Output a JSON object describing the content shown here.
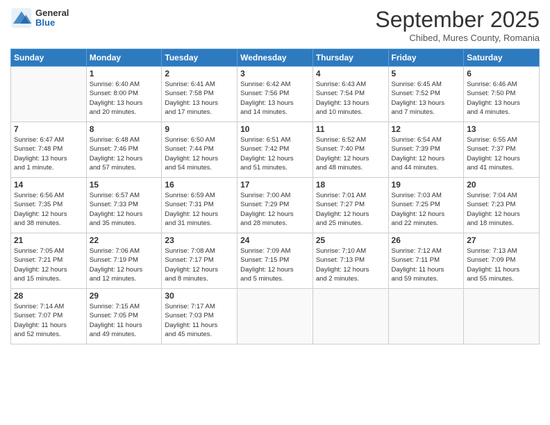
{
  "logo": {
    "general": "General",
    "blue": "Blue"
  },
  "title": "September 2025",
  "location": "Chibed, Mures County, Romania",
  "days_of_week": [
    "Sunday",
    "Monday",
    "Tuesday",
    "Wednesday",
    "Thursday",
    "Friday",
    "Saturday"
  ],
  "weeks": [
    [
      {
        "day": "",
        "info": ""
      },
      {
        "day": "1",
        "info": "Sunrise: 6:40 AM\nSunset: 8:00 PM\nDaylight: 13 hours\nand 20 minutes."
      },
      {
        "day": "2",
        "info": "Sunrise: 6:41 AM\nSunset: 7:58 PM\nDaylight: 13 hours\nand 17 minutes."
      },
      {
        "day": "3",
        "info": "Sunrise: 6:42 AM\nSunset: 7:56 PM\nDaylight: 13 hours\nand 14 minutes."
      },
      {
        "day": "4",
        "info": "Sunrise: 6:43 AM\nSunset: 7:54 PM\nDaylight: 13 hours\nand 10 minutes."
      },
      {
        "day": "5",
        "info": "Sunrise: 6:45 AM\nSunset: 7:52 PM\nDaylight: 13 hours\nand 7 minutes."
      },
      {
        "day": "6",
        "info": "Sunrise: 6:46 AM\nSunset: 7:50 PM\nDaylight: 13 hours\nand 4 minutes."
      }
    ],
    [
      {
        "day": "7",
        "info": "Sunrise: 6:47 AM\nSunset: 7:48 PM\nDaylight: 13 hours\nand 1 minute."
      },
      {
        "day": "8",
        "info": "Sunrise: 6:48 AM\nSunset: 7:46 PM\nDaylight: 12 hours\nand 57 minutes."
      },
      {
        "day": "9",
        "info": "Sunrise: 6:50 AM\nSunset: 7:44 PM\nDaylight: 12 hours\nand 54 minutes."
      },
      {
        "day": "10",
        "info": "Sunrise: 6:51 AM\nSunset: 7:42 PM\nDaylight: 12 hours\nand 51 minutes."
      },
      {
        "day": "11",
        "info": "Sunrise: 6:52 AM\nSunset: 7:40 PM\nDaylight: 12 hours\nand 48 minutes."
      },
      {
        "day": "12",
        "info": "Sunrise: 6:54 AM\nSunset: 7:39 PM\nDaylight: 12 hours\nand 44 minutes."
      },
      {
        "day": "13",
        "info": "Sunrise: 6:55 AM\nSunset: 7:37 PM\nDaylight: 12 hours\nand 41 minutes."
      }
    ],
    [
      {
        "day": "14",
        "info": "Sunrise: 6:56 AM\nSunset: 7:35 PM\nDaylight: 12 hours\nand 38 minutes."
      },
      {
        "day": "15",
        "info": "Sunrise: 6:57 AM\nSunset: 7:33 PM\nDaylight: 12 hours\nand 35 minutes."
      },
      {
        "day": "16",
        "info": "Sunrise: 6:59 AM\nSunset: 7:31 PM\nDaylight: 12 hours\nand 31 minutes."
      },
      {
        "day": "17",
        "info": "Sunrise: 7:00 AM\nSunset: 7:29 PM\nDaylight: 12 hours\nand 28 minutes."
      },
      {
        "day": "18",
        "info": "Sunrise: 7:01 AM\nSunset: 7:27 PM\nDaylight: 12 hours\nand 25 minutes."
      },
      {
        "day": "19",
        "info": "Sunrise: 7:03 AM\nSunset: 7:25 PM\nDaylight: 12 hours\nand 22 minutes."
      },
      {
        "day": "20",
        "info": "Sunrise: 7:04 AM\nSunset: 7:23 PM\nDaylight: 12 hours\nand 18 minutes."
      }
    ],
    [
      {
        "day": "21",
        "info": "Sunrise: 7:05 AM\nSunset: 7:21 PM\nDaylight: 12 hours\nand 15 minutes."
      },
      {
        "day": "22",
        "info": "Sunrise: 7:06 AM\nSunset: 7:19 PM\nDaylight: 12 hours\nand 12 minutes."
      },
      {
        "day": "23",
        "info": "Sunrise: 7:08 AM\nSunset: 7:17 PM\nDaylight: 12 hours\nand 8 minutes."
      },
      {
        "day": "24",
        "info": "Sunrise: 7:09 AM\nSunset: 7:15 PM\nDaylight: 12 hours\nand 5 minutes."
      },
      {
        "day": "25",
        "info": "Sunrise: 7:10 AM\nSunset: 7:13 PM\nDaylight: 12 hours\nand 2 minutes."
      },
      {
        "day": "26",
        "info": "Sunrise: 7:12 AM\nSunset: 7:11 PM\nDaylight: 11 hours\nand 59 minutes."
      },
      {
        "day": "27",
        "info": "Sunrise: 7:13 AM\nSunset: 7:09 PM\nDaylight: 11 hours\nand 55 minutes."
      }
    ],
    [
      {
        "day": "28",
        "info": "Sunrise: 7:14 AM\nSunset: 7:07 PM\nDaylight: 11 hours\nand 52 minutes."
      },
      {
        "day": "29",
        "info": "Sunrise: 7:15 AM\nSunset: 7:05 PM\nDaylight: 11 hours\nand 49 minutes."
      },
      {
        "day": "30",
        "info": "Sunrise: 7:17 AM\nSunset: 7:03 PM\nDaylight: 11 hours\nand 45 minutes."
      },
      {
        "day": "",
        "info": ""
      },
      {
        "day": "",
        "info": ""
      },
      {
        "day": "",
        "info": ""
      },
      {
        "day": "",
        "info": ""
      }
    ]
  ]
}
